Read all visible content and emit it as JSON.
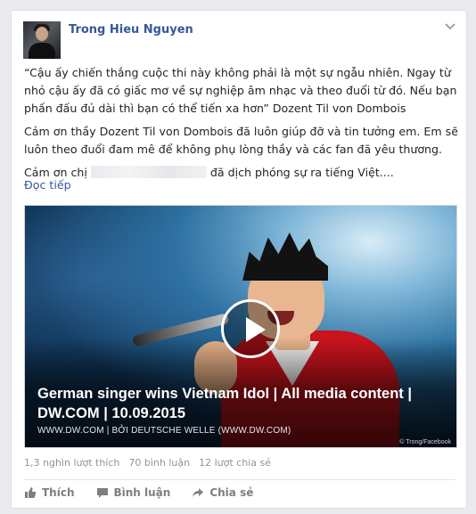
{
  "post": {
    "author": "Trong Hieu Nguyen",
    "paragraphs": [
      "“Cậu ấy chiến thắng cuộc thi này không phải là một sự ngẫu nhiên. Ngay từ nhỏ cậu ấy đã có giấc mơ về sự nghiệp âm nhạc và theo đuổi từ đó. Nếu bạn phấn đấu đủ dài thì bạn có thể tiến xa hơn” Dozent Til von Dombois",
      "Cảm ơn thầy Dozent Til von Dombois đã luôn giúp đỡ và tin tưởng em. Em sẽ luôn theo đuổi đam mê để không phụ lòng thầy và các fan đã yêu thương."
    ],
    "thanks_prefix": "Cảm ơn chị",
    "thanks_suffix": "đã dịch phóng sự ra tiếng Việt....",
    "see_more": "Đọc tiếp"
  },
  "media": {
    "title": "German singer wins Vietnam Idol | All media content | DW.COM | 10.09.2015",
    "source": "WWW.DW.COM | BỞI DEUTSCHE WELLE (WWW.DW.COM)",
    "credit": "© Trong/Facebook"
  },
  "stats": {
    "likes": "1,3 nghìn lượt thích",
    "comments": "70 bình luận",
    "shares": "12 lượt chia sẻ"
  },
  "actions": {
    "like": "Thích",
    "comment": "Bình luận",
    "share": "Chia sẻ"
  },
  "colors": {
    "link": "#365899",
    "jacket": "#c9141d",
    "background": "#e9ebee"
  }
}
